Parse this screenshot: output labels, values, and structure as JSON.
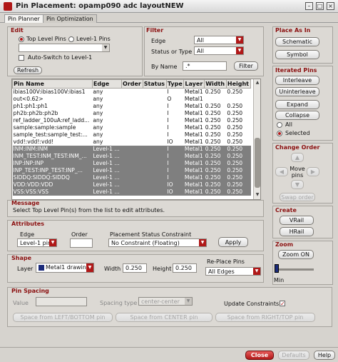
{
  "window": {
    "title": "Pin Placement: opamp090 adc layoutNEW",
    "min_glyph": "–",
    "max_glyph": "□",
    "close_glyph": "×"
  },
  "tabs": [
    {
      "label": "Pin Planner",
      "active": true
    },
    {
      "label": "Pin Optimization",
      "active": false
    }
  ],
  "edit": {
    "title": "Edit",
    "radio_top": "Top Level Pins",
    "radio_level1": "Level-1 Pins",
    "combo_value": "",
    "auto_switch": "Auto-Switch to Level-1",
    "refresh": "Refresh"
  },
  "filter": {
    "title": "Filter",
    "edge_label": "Edge",
    "edge_value": "All",
    "status_label": "Status or Type",
    "status_value": "All",
    "byname_label": "By Name",
    "byname_value": ".*",
    "filter_button": "Filter"
  },
  "table": {
    "columns": [
      "Pin Name",
      "Edge",
      "Order",
      "Status",
      "Type",
      "Layer",
      "Width",
      "Height"
    ],
    "rows": [
      {
        "name": "ibias100V:ibias100V:ibias1",
        "edge": "any",
        "order": "",
        "status": "",
        "type": "I",
        "layer": "Metal1",
        "width": "0.250",
        "height": "0.250",
        "sel": false
      },
      {
        "name": "out<0.62>",
        "edge": "any",
        "order": "",
        "status": "",
        "type": "O",
        "layer": "Metal1",
        "width": "",
        "height": "",
        "sel": false
      },
      {
        "name": "ph1:ph1:ph1",
        "edge": "any",
        "order": "",
        "status": "",
        "type": "I",
        "layer": "Metal1",
        "width": "0.250",
        "height": "0.250",
        "sel": false
      },
      {
        "name": "ph2b:ph2b:ph2b",
        "edge": "any",
        "order": "",
        "status": "",
        "type": "I",
        "layer": "Metal1",
        "width": "0.250",
        "height": "0.250",
        "sel": false
      },
      {
        "name": "ref_ladder_100uA:ref_ladd...",
        "edge": "any",
        "order": "",
        "status": "",
        "type": "I",
        "layer": "Metal1",
        "width": "0.250",
        "height": "0.250",
        "sel": false
      },
      {
        "name": "sample:sample:sample",
        "edge": "any",
        "order": "",
        "status": "",
        "type": "I",
        "layer": "Metal1",
        "width": "0.250",
        "height": "0.250",
        "sel": false
      },
      {
        "name": "sample_test:sample_test:...",
        "edge": "any",
        "order": "",
        "status": "",
        "type": "I",
        "layer": "Metal1",
        "width": "0.250",
        "height": "0.250",
        "sel": false
      },
      {
        "name": "vdd!:vdd!:vdd!",
        "edge": "any",
        "order": "",
        "status": "",
        "type": "IO",
        "layer": "Metal1",
        "width": "0.250",
        "height": "0.250",
        "sel": false
      },
      {
        "name": "INM:INM:INM",
        "edge": "Level-1 ...",
        "order": "",
        "status": "",
        "type": "I",
        "layer": "Metal1",
        "width": "0.250",
        "height": "0.250",
        "sel": true
      },
      {
        "name": "INM_TEST:INM_TEST:INM_...",
        "edge": "Level-1 ...",
        "order": "",
        "status": "",
        "type": "I",
        "layer": "Metal1",
        "width": "0.250",
        "height": "0.250",
        "sel": true
      },
      {
        "name": "INP:INP:INP",
        "edge": "Level-1 ...",
        "order": "",
        "status": "",
        "type": "I",
        "layer": "Metal1",
        "width": "0.250",
        "height": "0.250",
        "sel": true
      },
      {
        "name": "INP_TEST:INP_TEST:INP_...",
        "edge": "Level-1 ...",
        "order": "",
        "status": "",
        "type": "I",
        "layer": "Metal1",
        "width": "0.250",
        "height": "0.250",
        "sel": true
      },
      {
        "name": "SIDDQ:SIDDQ:SIDDQ",
        "edge": "Level-1 ...",
        "order": "",
        "status": "",
        "type": "I",
        "layer": "Metal1",
        "width": "0.250",
        "height": "0.250",
        "sel": true
      },
      {
        "name": "VDD:VDD:VDD",
        "edge": "Level-1 ...",
        "order": "",
        "status": "",
        "type": "IO",
        "layer": "Metal1",
        "width": "0.250",
        "height": "0.250",
        "sel": true
      },
      {
        "name": "VSS:VSS:VSS",
        "edge": "Level-1 ...",
        "order": "",
        "status": "",
        "type": "IO",
        "layer": "Metal1",
        "width": "0.250",
        "height": "0.250",
        "sel": true
      }
    ]
  },
  "place_as_in": {
    "title": "Place As In",
    "schematic": "Schematic",
    "symbol": "Symbol"
  },
  "iterated": {
    "title": "Iterated Pins",
    "interleave": "Interleave",
    "uninterleave": "Uninterleave",
    "expand": "Expand",
    "collapse": "Collapse",
    "radio_all": "All",
    "radio_selected": "Selected"
  },
  "change_order": {
    "title": "Change Order",
    "move_pins": "Move pins",
    "swap_order": "Swap order"
  },
  "message": {
    "title": "Message",
    "text": "Select Top Level Pin(s) from the list to edit attributes."
  },
  "attributes": {
    "title": "Attributes",
    "edge_label": "Edge",
    "edge_value": "Level-1 pin",
    "order_label": "Order",
    "order_value": "",
    "constraint_label": "Placement Status Constraint",
    "constraint_value": "No Constraint (Floating)",
    "apply": "Apply"
  },
  "shape": {
    "title": "Shape",
    "layer_label": "Layer",
    "layer_value": "Metal1 drawing",
    "width_label": "Width",
    "width_value": "0.250",
    "height_label": "Height",
    "height_value": "0.250",
    "replace_label": "Re-Place Pins",
    "replace_value": "All Edges"
  },
  "create": {
    "title": "Create",
    "vrail": "VRail",
    "hrail": "HRail"
  },
  "zoom": {
    "title": "Zoom",
    "zoom_on": "Zoom ON",
    "min_label": "Min",
    "level": 0.1
  },
  "pin_spacing": {
    "title": "Pin Spacing",
    "value_label": "Value",
    "value": "",
    "spacing_type_label": "Spacing type",
    "spacing_type_value": "center-center",
    "update_constraints": "Update Constraints",
    "btn_left_bottom": "Space from LEFT/BOTTOM pin",
    "btn_center": "Space from CENTER pin",
    "btn_right_top": "Space from RIGHT/TOP pin"
  },
  "footer": {
    "close": "Close",
    "defaults": "Defaults",
    "help": "Help"
  },
  "colors": {
    "accent": "#b01818",
    "section_title": "#8b1010",
    "selected_row": "#7f7f7f"
  }
}
